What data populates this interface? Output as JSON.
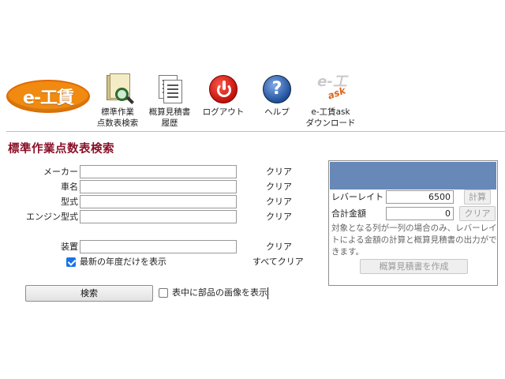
{
  "toolbar": {
    "logo_text": "e-工賃",
    "items": [
      {
        "label": "標準作業\n点数表検索",
        "icon": "book-search-icon"
      },
      {
        "label": "概算見積書\n履歴",
        "icon": "document-history-icon"
      },
      {
        "label": "ログアウト",
        "icon": "power-icon"
      },
      {
        "label": "ヘルプ",
        "icon": "help-icon"
      },
      {
        "label": "e-工賃ask\nダウンロード",
        "icon": "e-ask-logo-icon"
      }
    ]
  },
  "page": {
    "title": "標準作業点数表検索"
  },
  "form": {
    "fields": [
      {
        "label": "メーカー",
        "value": "",
        "clear": "クリア"
      },
      {
        "label": "車名",
        "value": "",
        "clear": "クリア"
      },
      {
        "label": "型式",
        "value": "",
        "clear": "クリア"
      },
      {
        "label": "エンジン型式",
        "value": "",
        "clear": "クリア"
      },
      {
        "label": "装置",
        "value": "",
        "clear": "クリア"
      }
    ],
    "latest_year_checkbox": {
      "label": "最新の年度だけを表示",
      "checked": true
    },
    "clear_all": "すべてクリア",
    "search_button": "検索",
    "show_images_checkbox": {
      "label": "表中に部品の画像を表示",
      "checked": false
    }
  },
  "panel": {
    "lever_rate_label": "レバーレイト",
    "lever_rate_value": "6500",
    "calc_button": "計算",
    "total_label": "合計金額",
    "total_value": "0",
    "clear_button": "クリア",
    "note": "対象となる列が一列の場合のみ、レバーレイトによる金額の計算と概算見積書の出力ができます。",
    "create_estimate_button": "概算見積書を作成",
    "header_color": "#6888b8"
  },
  "colors": {
    "title": "#8a1028",
    "logo": "#f08a10"
  }
}
